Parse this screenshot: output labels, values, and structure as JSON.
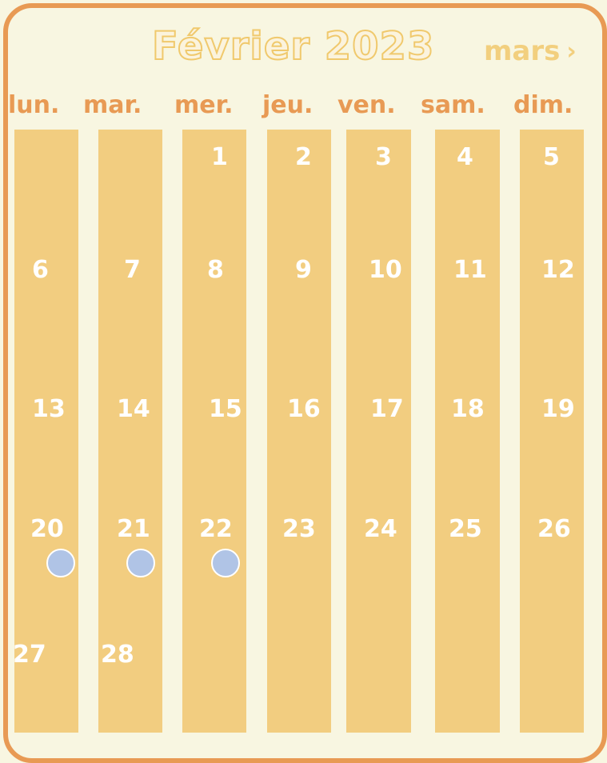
{
  "header": {
    "title": "Février 2023",
    "next_month_label": "mars",
    "next_icon": "chevron-right-icon"
  },
  "weekdays": [
    "lun.",
    "mar.",
    "mer.",
    "jeu.",
    "ven.",
    "sam.",
    "dim."
  ],
  "days": [
    "1",
    "2",
    "3",
    "4",
    "5",
    "6",
    "7",
    "8",
    "9",
    "10",
    "11",
    "12",
    "13",
    "14",
    "15",
    "16",
    "17",
    "18",
    "19",
    "20",
    "21",
    "22",
    "23",
    "24",
    "25",
    "26",
    "27",
    "28"
  ],
  "event_markers": [
    {
      "day": "20"
    },
    {
      "day": "21"
    },
    {
      "day": "22"
    }
  ],
  "colors": {
    "background": "#f8f6e1",
    "border": "#e89a54",
    "column": "#f2cd80",
    "weekday_text": "#e89a54",
    "marker": "#b0c4e6"
  }
}
